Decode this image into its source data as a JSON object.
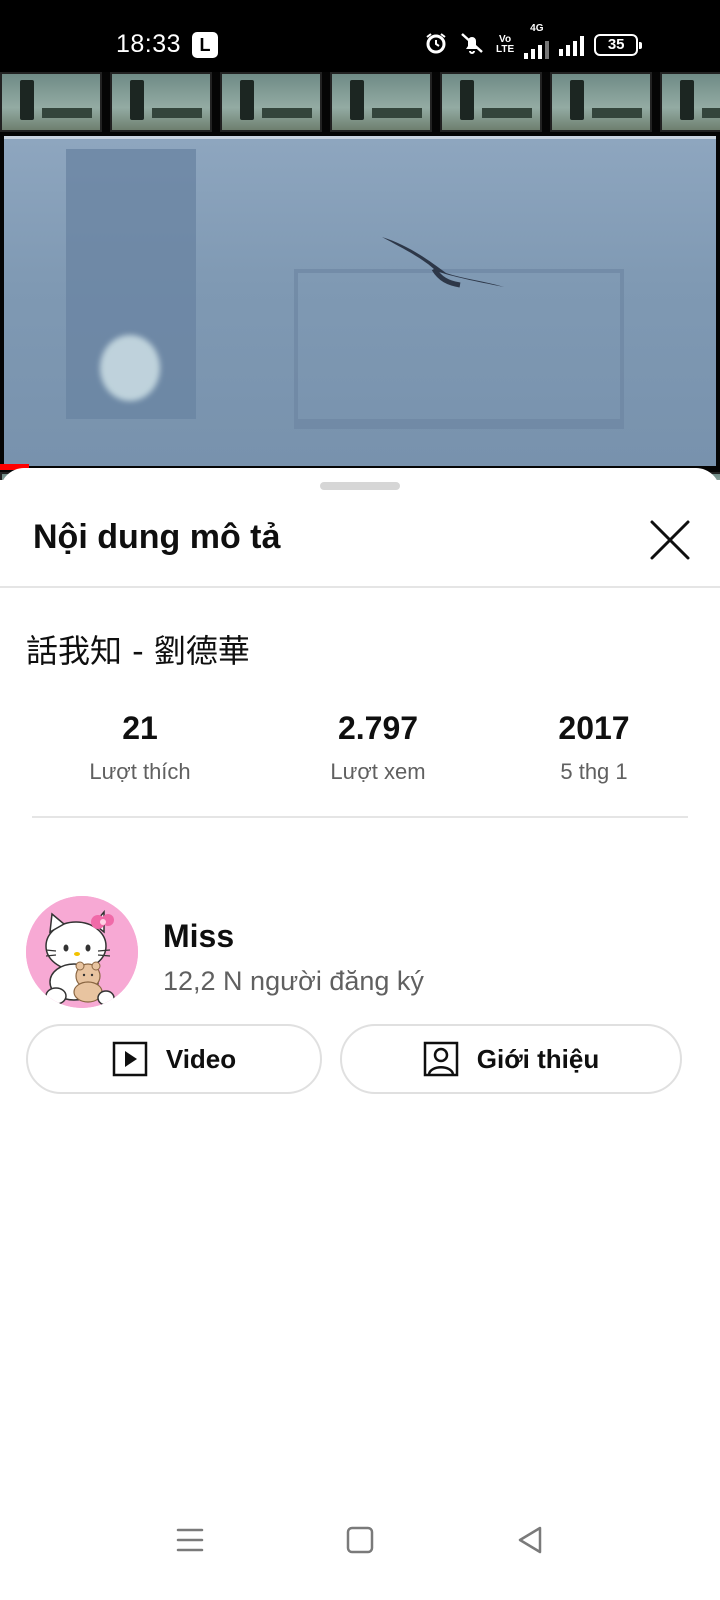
{
  "status_bar": {
    "time": "18:33",
    "app_badge": "L",
    "volte_line1": "Vo",
    "volte_line2": "LTE",
    "network": "4G",
    "battery": "35",
    "icons": [
      "alarm-icon",
      "silent-icon",
      "volte-icon",
      "4g-signal-icon",
      "signal-icon",
      "battery-icon"
    ]
  },
  "video_player": {
    "progress_fraction": 0.04,
    "progress_color": "#ff0000"
  },
  "sheet": {
    "title": "Nội dung mô tả",
    "close_icon": "close-icon"
  },
  "video": {
    "title": "話我知 - 劉德華"
  },
  "stats": [
    {
      "value": "21",
      "label": "Lượt thích"
    },
    {
      "value": "2.797",
      "label": "Lượt xem"
    },
    {
      "value": "2017",
      "label": "5 thg 1"
    }
  ],
  "channel": {
    "name": "Miss",
    "subscribers": "12,2 N người đăng ký",
    "avatar_icon": "hello-kitty-avatar",
    "avatar_bg": "#f7a9d4"
  },
  "buttons": {
    "videos_label": "Video",
    "videos_icon": "play-box-icon",
    "about_label": "Giới thiệu",
    "about_icon": "person-box-icon"
  },
  "nav": {
    "icons": [
      "menu-icon",
      "home-square-icon",
      "back-triangle-icon"
    ]
  }
}
